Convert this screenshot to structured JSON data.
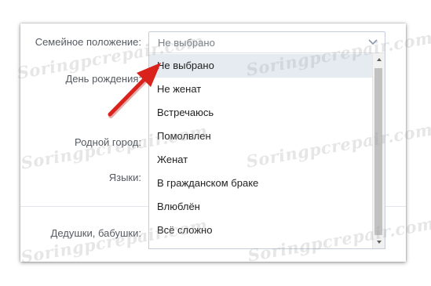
{
  "form": {
    "labels": {
      "family_status": "Семейное положение:",
      "birthday": "День рождения:",
      "hometown": "Родной город:",
      "languages": "Языки:",
      "grandparents": "Дедушки, бабушки:"
    }
  },
  "family_status_select": {
    "current_value": "Не выбрано",
    "chevron_icon": "chevron-down-icon",
    "options": [
      {
        "label": "Не выбрано",
        "selected": true
      },
      {
        "label": "Не женат",
        "selected": false
      },
      {
        "label": "Встречаюсь",
        "selected": false
      },
      {
        "label": "Помолвлен",
        "selected": false
      },
      {
        "label": "Женат",
        "selected": false
      },
      {
        "label": "В гражданском браке",
        "selected": false
      },
      {
        "label": "Влюблён",
        "selected": false
      },
      {
        "label": "Всё сложно",
        "selected": false
      }
    ]
  },
  "scrollbar": {
    "up_icon": "scroll-up-arrow-icon",
    "down_icon": "scroll-down-arrow-icon"
  },
  "annotation": {
    "arrow_icon": "red-pointer-arrow-icon",
    "color": "#d9221c"
  },
  "watermark": {
    "text": "Soringpcrepair.com"
  },
  "colors": {
    "selected_option_bg": "#e5ebf1",
    "border": "#c5ced8",
    "label_text": "#555a60",
    "option_text": "#222222"
  }
}
